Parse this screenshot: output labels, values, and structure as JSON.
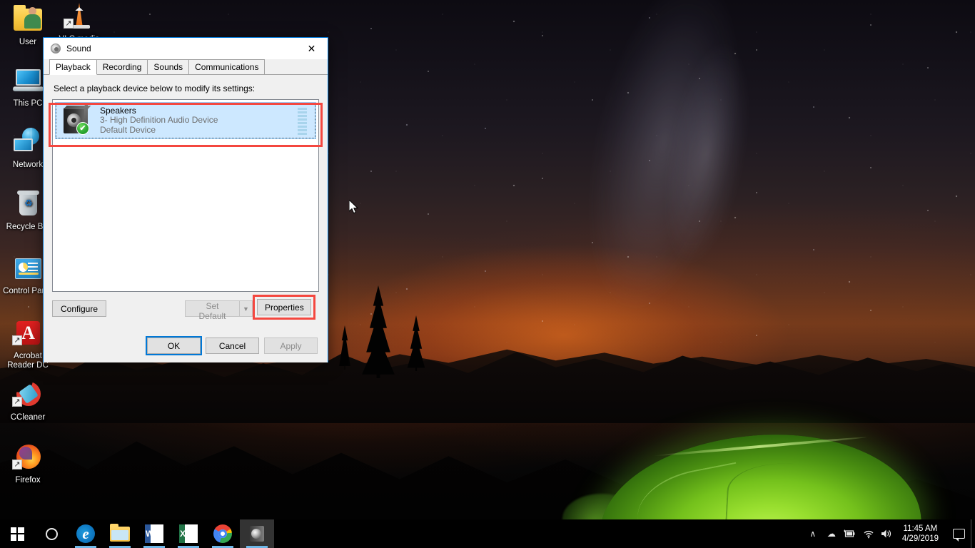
{
  "desktop": {
    "icons": [
      {
        "label": "User",
        "icon": "user-folder-icon"
      },
      {
        "label": "VLC media",
        "icon": "vlc-media-player-icon"
      },
      {
        "label": "This PC",
        "icon": "this-pc-icon"
      },
      {
        "label": "Network",
        "icon": "network-icon"
      },
      {
        "label": "Recycle Bin",
        "icon": "recycle-bin-icon"
      },
      {
        "label": "Control Panel",
        "icon": "control-panel-icon"
      },
      {
        "label": "Acrobat Reader DC",
        "icon": "acrobat-reader-icon"
      },
      {
        "label": "CCleaner",
        "icon": "ccleaner-icon"
      },
      {
        "label": "Firefox",
        "icon": "firefox-icon"
      }
    ],
    "wallpaper_description": "night sky with milky way over mountains and glowing green tent"
  },
  "dialog": {
    "title": "Sound",
    "title_icon": "speaker-icon",
    "close_label": "✕",
    "tabs": [
      {
        "label": "Playback",
        "active": true
      },
      {
        "label": "Recording",
        "active": false
      },
      {
        "label": "Sounds",
        "active": false
      },
      {
        "label": "Communications",
        "active": false
      }
    ],
    "prompt": "Select a playback device below to modify its settings:",
    "devices": [
      {
        "name": "Speakers",
        "description": "3- High Definition Audio Device",
        "status": "Default Device",
        "selected": true,
        "default_badge": "✔",
        "meter_segments": 8
      }
    ],
    "buttons": {
      "configure": "Configure",
      "set_default": "Set Default",
      "set_default_arrow": "▼",
      "properties": "Properties",
      "ok": "OK",
      "cancel": "Cancel",
      "apply": "Apply"
    },
    "highlights": {
      "color": "#f4473f",
      "targets": [
        "device-list-row",
        "properties-button"
      ]
    },
    "focus_color": "#0078d7"
  },
  "taskbar": {
    "items": [
      {
        "name": "start-button",
        "label": "Start"
      },
      {
        "name": "cortana-search",
        "label": "Cortana"
      },
      {
        "name": "edge",
        "label": "Microsoft Edge",
        "glyph": "e"
      },
      {
        "name": "file-explorer",
        "label": "File Explorer"
      },
      {
        "name": "word",
        "label": "Word",
        "glyph": "W"
      },
      {
        "name": "excel",
        "label": "Excel",
        "glyph": "X"
      },
      {
        "name": "chrome",
        "label": "Google Chrome"
      },
      {
        "name": "sound-window",
        "label": "Sound"
      }
    ],
    "tray": {
      "chevron": "∧",
      "onedrive": "☁",
      "battery": "▮",
      "wifi": "◠",
      "volume": "🔊",
      "time": "11:45 AM",
      "date": "4/29/2019"
    }
  }
}
